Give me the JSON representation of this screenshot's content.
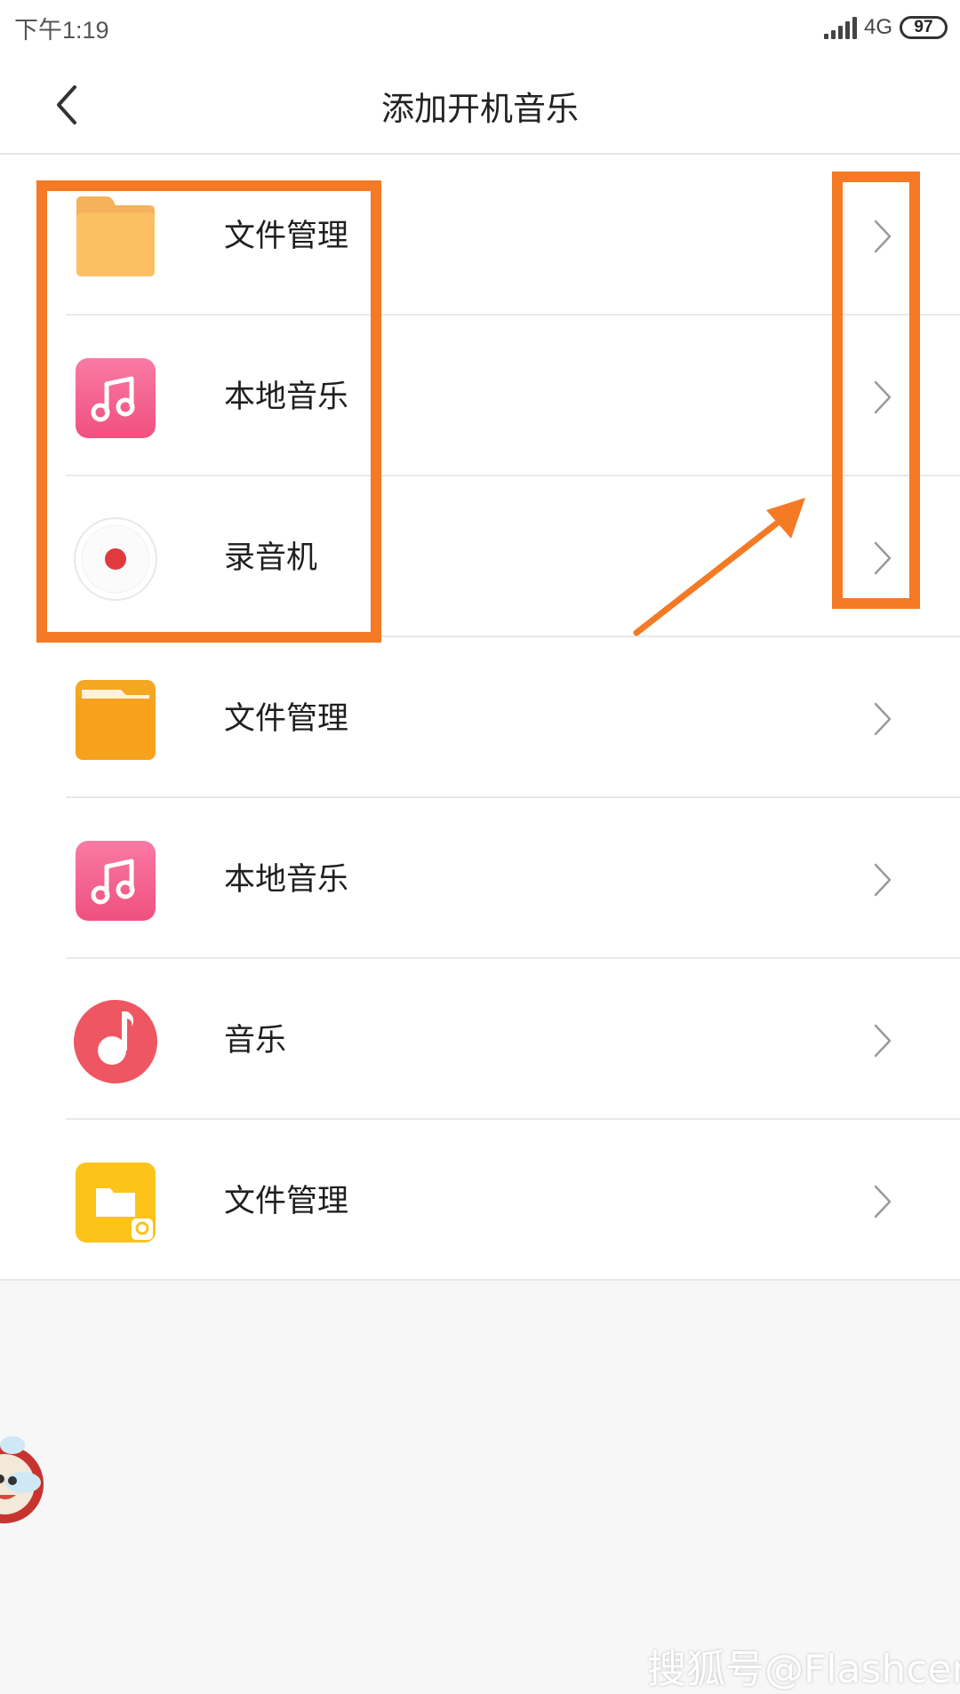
{
  "status_bar": {
    "time": "下午1:19",
    "network": "4G",
    "battery": "97"
  },
  "header": {
    "title": "添加开机音乐",
    "back_icon": "chevron-left-icon"
  },
  "list": [
    {
      "label": "文件管理",
      "icon": "folder-icon"
    },
    {
      "label": "本地音乐",
      "icon": "music-note-icon"
    },
    {
      "label": "录音机",
      "icon": "recorder-icon"
    },
    {
      "label": "文件管理",
      "icon": "folder-icon"
    },
    {
      "label": "本地音乐",
      "icon": "music-note-icon"
    },
    {
      "label": "音乐",
      "icon": "music-app-icon"
    },
    {
      "label": "文件管理",
      "icon": "qq-folder-icon"
    }
  ],
  "annotations": {
    "highlight_color": "#f47a25"
  },
  "watermark": "搜狐号@Flashcer"
}
